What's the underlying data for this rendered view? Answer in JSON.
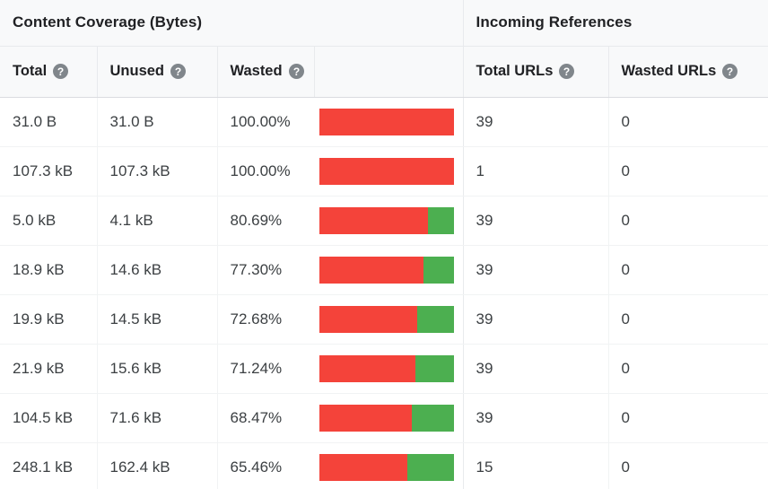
{
  "groups": [
    {
      "id": "content-coverage",
      "label": "Content Coverage (Bytes)"
    },
    {
      "id": "incoming-references",
      "label": "Incoming References"
    }
  ],
  "columns": [
    {
      "id": "total",
      "label": "Total",
      "help": "help-icon"
    },
    {
      "id": "unused",
      "label": "Unused",
      "help": "help-icon"
    },
    {
      "id": "wasted",
      "label": "Wasted",
      "help": "help-icon"
    },
    {
      "id": "wasted-bar",
      "label": "",
      "help": null
    },
    {
      "id": "total-urls",
      "label": "Total URLs",
      "help": "help-icon"
    },
    {
      "id": "wasted-urls",
      "label": "Wasted URLs",
      "help": "help-icon"
    }
  ],
  "colors": {
    "wasted": "#f4433a",
    "used": "#4caf50",
    "header_background": "#f8f9fa",
    "row_border": "#f1f3f4",
    "text": "#3c4043",
    "heading_text": "#202124",
    "help_icon": "#80868b"
  },
  "rows": [
    {
      "total": "31.0 B",
      "unused": "31.0 B",
      "wasted": "100.00%",
      "wasted_pct": 100.0,
      "total_urls": "39",
      "wasted_urls": "0"
    },
    {
      "total": "107.3 kB",
      "unused": "107.3 kB",
      "wasted": "100.00%",
      "wasted_pct": 100.0,
      "total_urls": "1",
      "wasted_urls": "0"
    },
    {
      "total": "5.0 kB",
      "unused": "4.1 kB",
      "wasted": "80.69%",
      "wasted_pct": 80.69,
      "total_urls": "39",
      "wasted_urls": "0"
    },
    {
      "total": "18.9 kB",
      "unused": "14.6 kB",
      "wasted": "77.30%",
      "wasted_pct": 77.3,
      "total_urls": "39",
      "wasted_urls": "0"
    },
    {
      "total": "19.9 kB",
      "unused": "14.5 kB",
      "wasted": "72.68%",
      "wasted_pct": 72.68,
      "total_urls": "39",
      "wasted_urls": "0"
    },
    {
      "total": "21.9 kB",
      "unused": "15.6 kB",
      "wasted": "71.24%",
      "wasted_pct": 71.24,
      "total_urls": "39",
      "wasted_urls": "0"
    },
    {
      "total": "104.5 kB",
      "unused": "71.6 kB",
      "wasted": "68.47%",
      "wasted_pct": 68.47,
      "total_urls": "39",
      "wasted_urls": "0"
    },
    {
      "total": "248.1 kB",
      "unused": "162.4 kB",
      "wasted": "65.46%",
      "wasted_pct": 65.46,
      "total_urls": "15",
      "wasted_urls": "0"
    }
  ]
}
